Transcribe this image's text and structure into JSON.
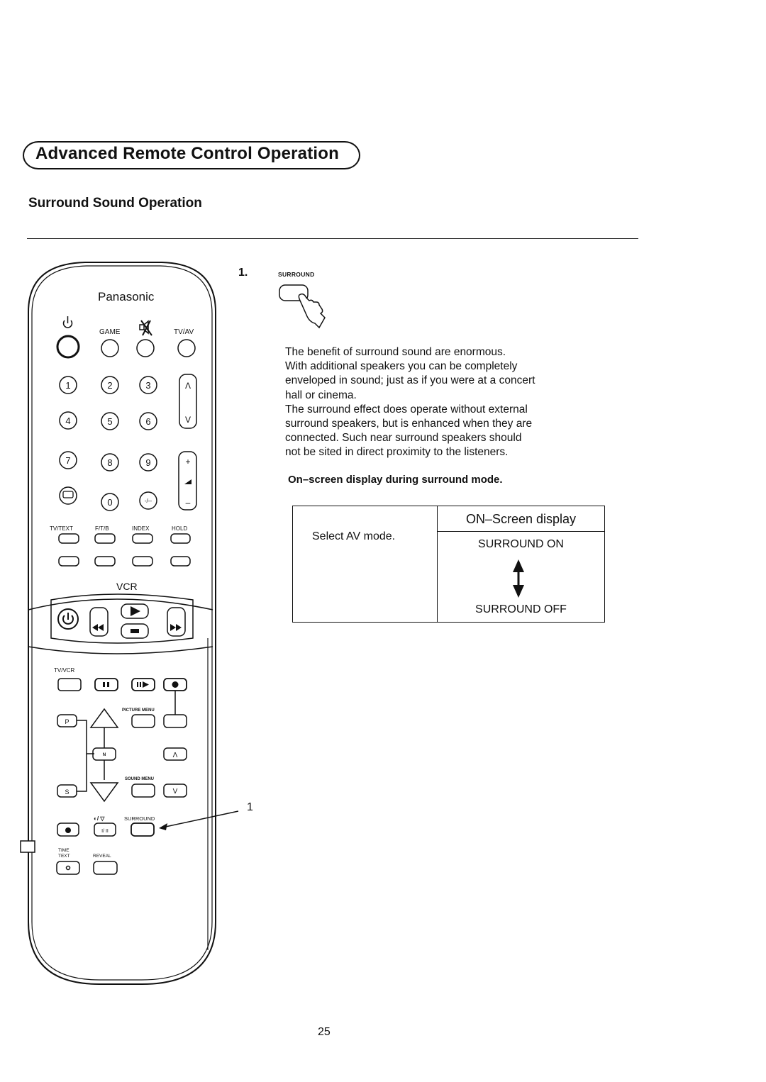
{
  "header": {
    "title": "Advanced Remote Control Operation",
    "subtitle": "Surround Sound Operation"
  },
  "remote": {
    "brand": "Panasonic",
    "top_labels": [
      "GAME",
      "TV/AV"
    ],
    "number_keys": [
      "1",
      "2",
      "3",
      "4",
      "5",
      "6",
      "7",
      "8",
      "9",
      "0",
      "-/--"
    ],
    "channel_rocker": [
      "Λ",
      "V"
    ],
    "volume_rocker": [
      "+",
      "–"
    ],
    "text_labels": [
      "TV/TEXT",
      "F/T/B",
      "INDEX",
      "HOLD"
    ],
    "vcr_label": "VCR",
    "tvvcr_label": "TV/VCR",
    "picture_menu_label": "PICTURE MENU",
    "sound_menu_label": "SOUND MENU",
    "p_key": "P",
    "n_key": "N",
    "s_key": "S",
    "up_key": "Λ",
    "down_key": "V",
    "stereo_label": "◐/ ▽",
    "stereo_key": "I/ II",
    "surround_label": "SURROUND",
    "time_text_label_1": "TIME",
    "time_text_label_2": "TEXT",
    "time_text_key": "o",
    "reveal_label": "REVEAL",
    "callout_number": "1"
  },
  "step": {
    "number": "1.",
    "button_label": "SURROUND"
  },
  "description": [
    "The benefit of surround sound are enormous.",
    "With additional speakers you can be completely",
    "enveloped in sound; just as if you were at a concert",
    "hall or cinema.",
    "The surround effect does operate without external",
    "surround speakers, but is enhanced when they are",
    "connected. Such near surround speakers should",
    "not be sited in direct proximity to the listeners."
  ],
  "osd": {
    "heading": "On–screen display during surround mode.",
    "left_cell": "Select AV mode.",
    "column_header": "ON–Screen display",
    "state_on": "SURROUND ON",
    "state_off": "SURROUND OFF"
  },
  "footer": {
    "page_number": "25"
  }
}
